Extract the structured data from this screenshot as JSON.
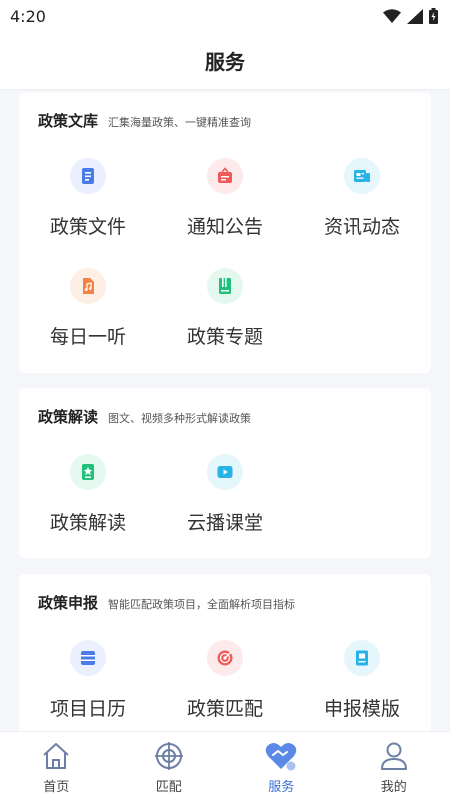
{
  "status": {
    "time": "4:20"
  },
  "header": {
    "title": "服务"
  },
  "sections": [
    {
      "title": "政策文库",
      "subtitle": "汇集海量政策、一键精准查询",
      "items": [
        {
          "label": "政策文件",
          "icon": "document-icon",
          "color": "#4a7ce8",
          "bg": "#eaf0fd"
        },
        {
          "label": "通知公告",
          "icon": "notice-icon",
          "color": "#f05a5a",
          "bg": "#fdebec"
        },
        {
          "label": "资讯动态",
          "icon": "news-icon",
          "color": "#27b3e8",
          "bg": "#e6f6fd"
        },
        {
          "label": "每日一听",
          "icon": "audio-file-icon",
          "color": "#f38244",
          "bg": "#fdefe6"
        },
        {
          "label": "政策专题",
          "icon": "book-icon",
          "color": "#22c07a",
          "bg": "#e5f8ef"
        }
      ]
    },
    {
      "title": "政策解读",
      "subtitle": "图文、视频多种形式解读政策",
      "items": [
        {
          "label": "政策解读",
          "icon": "interpret-icon",
          "color": "#22c07a",
          "bg": "#e5f8ef"
        },
        {
          "label": "云播课堂",
          "icon": "video-icon",
          "color": "#27b3e8",
          "bg": "#e6f6fd"
        }
      ]
    },
    {
      "title": "政策申报",
      "subtitle": "智能匹配政策项目，全面解析项目指标",
      "items": [
        {
          "label": "项目日历",
          "icon": "calendar-icon",
          "color": "#4a7ce8",
          "bg": "#eaf0fd"
        },
        {
          "label": "政策匹配",
          "icon": "target-icon",
          "color": "#f05a5a",
          "bg": "#fdebec"
        },
        {
          "label": "申报模版",
          "icon": "template-icon",
          "color": "#27b3e8",
          "bg": "#e6f6fd"
        }
      ]
    }
  ],
  "tabs": [
    {
      "label": "首页",
      "icon": "home-icon"
    },
    {
      "label": "匹配",
      "icon": "match-icon"
    },
    {
      "label": "服务",
      "icon": "service-icon"
    },
    {
      "label": "我的",
      "icon": "profile-icon"
    }
  ],
  "active_tab": "服务",
  "colors": {
    "accent": "#3a6fd8",
    "background": "#f4f6f9"
  }
}
